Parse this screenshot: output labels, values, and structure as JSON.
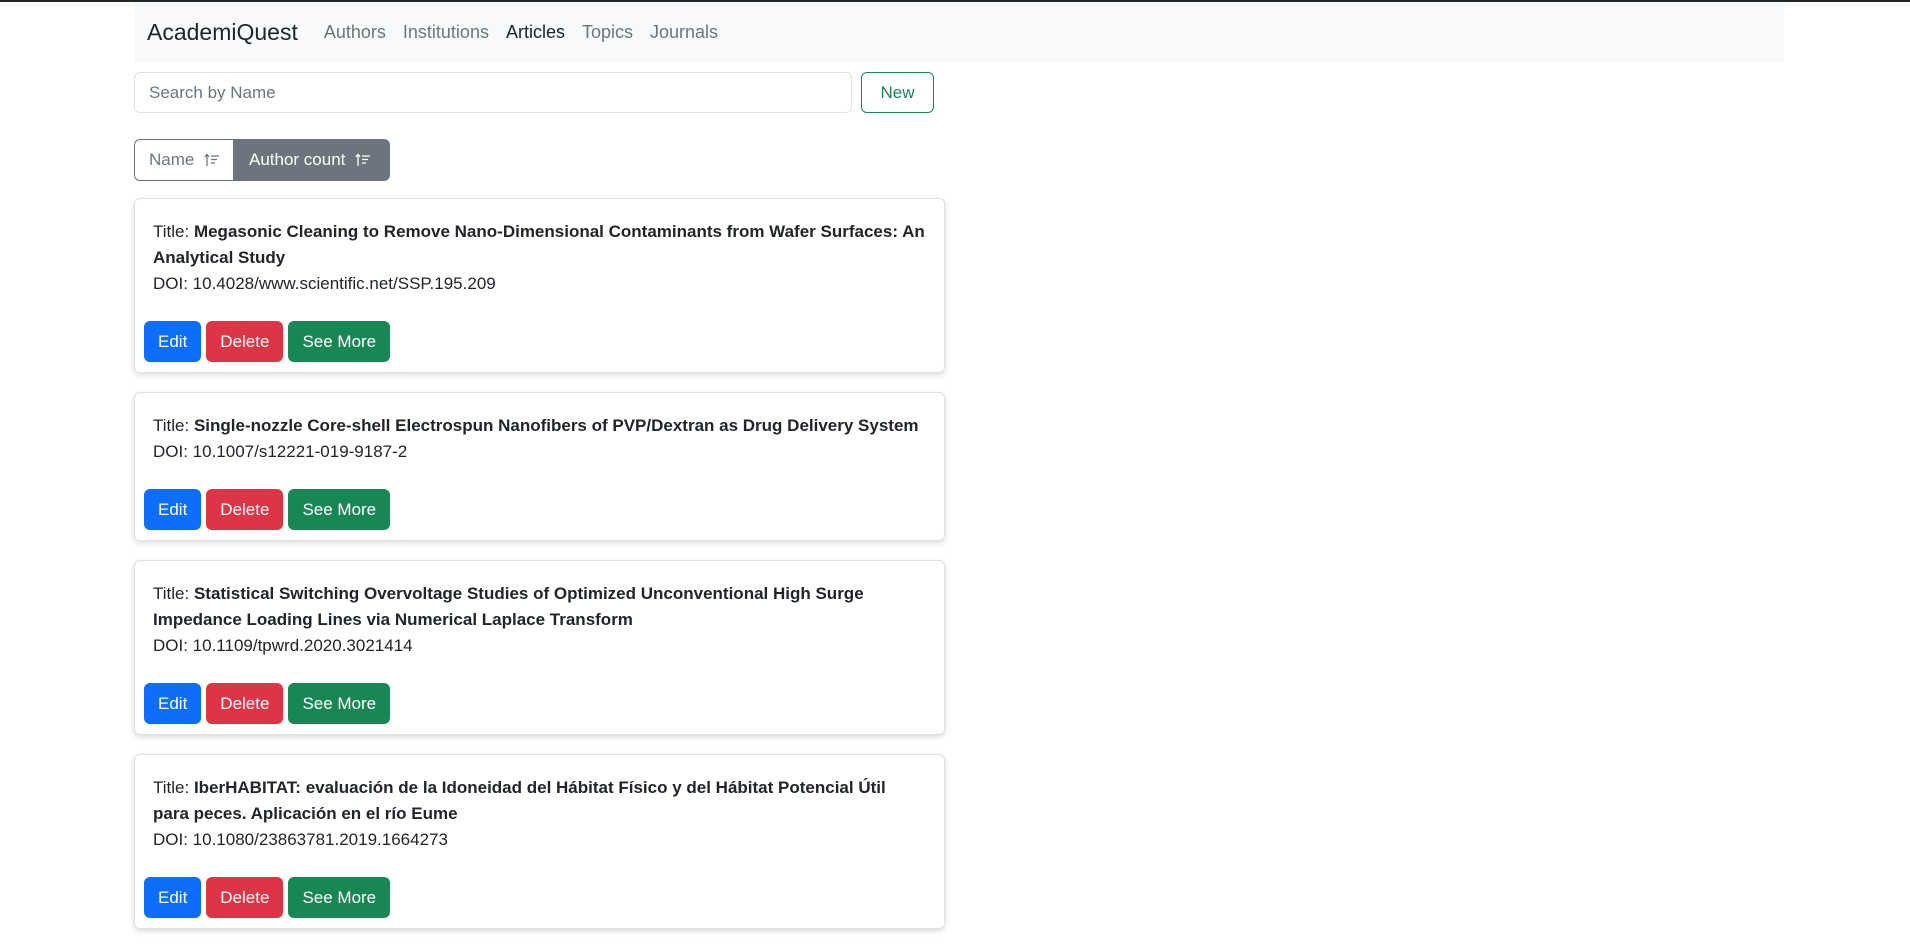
{
  "nav": {
    "brand": "AcademiQuest",
    "links": [
      "Authors",
      "Institutions",
      "Articles",
      "Topics",
      "Journals"
    ],
    "active": "Articles"
  },
  "search": {
    "placeholder": "Search by Name",
    "value": "",
    "new_label": "New"
  },
  "sort": {
    "name_label": "Name",
    "count_label": "Author count",
    "active": "Author count"
  },
  "labels": {
    "title_prefix": "Title: ",
    "doi_prefix": "DOI: ",
    "edit": "Edit",
    "delete": "Delete",
    "see_more": "See More"
  },
  "articles": [
    {
      "title": "Megasonic Cleaning to Remove Nano-Dimensional Contaminants from Wafer Surfaces: An Analytical Study",
      "doi": "10.4028/www.scientific.net/SSP.195.209"
    },
    {
      "title": "Single-nozzle Core-shell Electrospun Nanofibers of PVP/Dextran as Drug Delivery System",
      "doi": "10.1007/s12221-019-9187-2"
    },
    {
      "title": "Statistical Switching Overvoltage Studies of Optimized Unconventional High Surge Impedance Loading Lines via Numerical Laplace Transform",
      "doi": "10.1109/tpwrd.2020.3021414"
    },
    {
      "title": "IberHABITAT: evaluación de la Idoneidad del Hábitat Físico y del Hábitat Potencial Útil para peces. Aplicación en el río Eume",
      "doi": "10.1080/23863781.2019.1664273"
    }
  ],
  "colors": {
    "primary": "#0d6efd",
    "danger": "#dc3545",
    "success": "#198754",
    "secondary": "#6c757d",
    "navbar_bg": "#f8f9fa"
  }
}
